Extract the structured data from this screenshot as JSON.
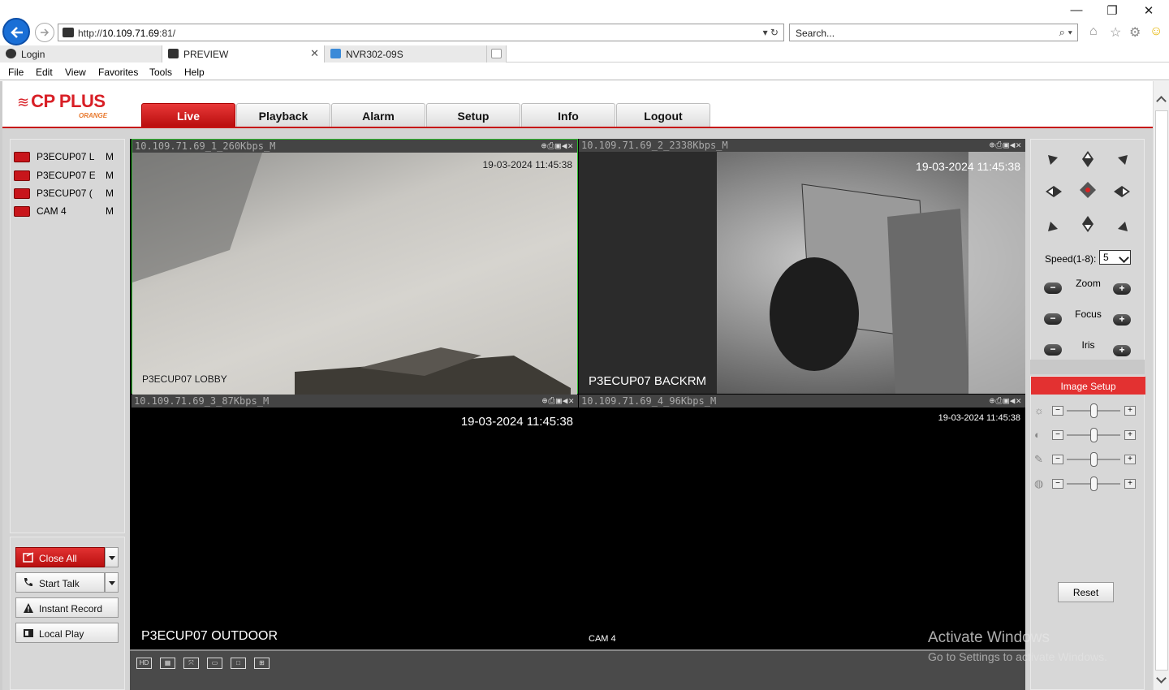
{
  "browser": {
    "url_prefix": "http://",
    "url_host": "10.109.71.69",
    "url_suffix": ":81/",
    "search_placeholder": "Search...",
    "tabs": [
      {
        "label": "Login"
      },
      {
        "label": "PREVIEW"
      },
      {
        "label": "NVR302-09S"
      }
    ],
    "menu": [
      "File",
      "Edit",
      "View",
      "Favorites",
      "Tools",
      "Help"
    ]
  },
  "app": {
    "brand": "CP PLUS",
    "brand_sub": "ORANGE",
    "nav": [
      {
        "label": "Live",
        "active": true
      },
      {
        "label": "Playback"
      },
      {
        "label": "Alarm"
      },
      {
        "label": "Setup"
      },
      {
        "label": "Info"
      },
      {
        "label": "Logout"
      }
    ],
    "cameras": [
      {
        "name": "P3ECUP07 L",
        "stream": "M"
      },
      {
        "name": "P3ECUP07 E",
        "stream": "M"
      },
      {
        "name": "P3ECUP07 (",
        "stream": "M"
      },
      {
        "name": "CAM 4",
        "stream": "M"
      }
    ],
    "actions": {
      "close_all": "Close All",
      "start_talk": "Start Talk",
      "instant_record": "Instant Record",
      "local_play": "Local Play"
    },
    "views": [
      {
        "title": "10.109.71.69_1_260Kbps_M",
        "timestamp": "19-03-2024 11:45:38",
        "name": "P3ECUP07 LOBBY",
        "selected": true
      },
      {
        "title": "10.109.71.69_2_2338Kbps_M",
        "timestamp": "19-03-2024 11:45:38",
        "name": "P3ECUP07 BACKRM"
      },
      {
        "title": "10.109.71.69_3_87Kbps_M",
        "timestamp": "19-03-2024 11:45:38",
        "name": "P3ECUP07 OUTDOOR"
      },
      {
        "title": "10.109.71.69_4_96Kbps_M",
        "timestamp": "19-03-2024 11:45:38",
        "name": "CAM 4"
      }
    ],
    "ptz": {
      "speed_label": "Speed(1-8):",
      "speed_value": "5",
      "zoom": "Zoom",
      "focus": "Focus",
      "iris": "Iris"
    },
    "image_setup": {
      "title": "Image Setup",
      "reset": "Reset",
      "sliders": [
        {
          "icon": "brightness-icon",
          "value": 0.5
        },
        {
          "icon": "contrast-icon",
          "value": 0.5
        },
        {
          "icon": "saturation-icon",
          "value": 0.5
        },
        {
          "icon": "hue-icon",
          "value": 0.5
        }
      ]
    }
  },
  "watermark": {
    "line1": "Activate Windows",
    "line2": "Go to Settings to activate Windows."
  }
}
